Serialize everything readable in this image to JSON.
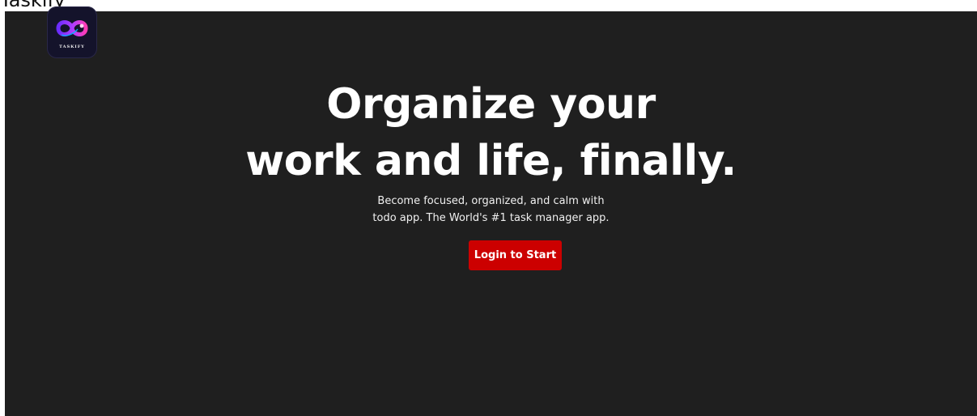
{
  "browser": {
    "partial_heading_text": "Taskify"
  },
  "logo": {
    "caption": "TASKIFY",
    "icon": "infinity-logo-icon",
    "gradient_start": "#6a2cff",
    "gradient_end": "#ff3cb4"
  },
  "hero": {
    "headline_line1": "Organize your",
    "headline_line2": "work and life, finally.",
    "subtitle_line1": "Become focused, organized, and calm with",
    "subtitle_line2": "todo app. The World's #1 task manager app.",
    "cta_label": "Login to Start"
  },
  "colors": {
    "background": "#1f1f1f",
    "cta": "#cc0000",
    "text": "#ffffff"
  }
}
